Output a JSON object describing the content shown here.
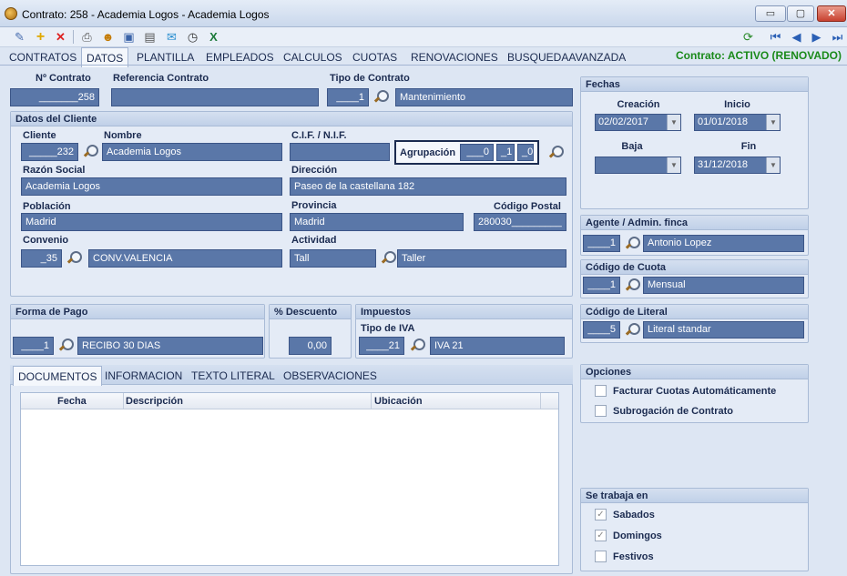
{
  "window": {
    "title": "Contrato: 258 - Academia Logos - Academia Logos",
    "minimize": "▭",
    "maximize": "▢",
    "close": "✕"
  },
  "tabs": [
    "CONTRATOS",
    "DATOS",
    "PLANTILLA",
    "EMPLEADOS",
    "CALCULOS",
    "CUOTAS",
    "RENOVACIONES",
    "BUSQUEDAAVANZADA"
  ],
  "status": "Contrato: ACTIVO (RENOVADO)",
  "contract": {
    "num_label": "Nº Contrato",
    "num_value": "_______258",
    "ref_label": "Referencia Contrato",
    "ref_value": "",
    "tipo_label": "Tipo de Contrato",
    "tipo_code": "____1",
    "tipo_value": "Mantenimiento"
  },
  "cliente": {
    "header": "Datos del Cliente",
    "cliente_label": "Cliente",
    "cliente_code": "_____232",
    "nombre_label": "Nombre",
    "nombre_value": "Academia Logos",
    "cif_label": "C.I.F. / N.I.F.",
    "cif_value": "",
    "agrupacion_label": "Agrupación",
    "agr1": "___0",
    "agr2": "_1",
    "agr3": "_0",
    "razon_label": "Razón Social",
    "razon_value": "Academia Logos",
    "direccion_label": "Dirección",
    "direccion_value": "Paseo de la castellana 182",
    "poblacion_label": "Población",
    "poblacion_value": "Madrid",
    "provincia_label": "Provincia",
    "provincia_value": "Madrid",
    "cp_label": "Código Postal",
    "cp_value": "280030_________",
    "convenio_label": "Convenio",
    "convenio_code": "_35",
    "convenio_value": "CONV.VALENCIA",
    "actividad_label": "Actividad",
    "actividad_code": "Tall",
    "actividad_value": "Taller"
  },
  "pago": {
    "header": "Forma de Pago",
    "code": "____1",
    "value": "RECIBO 30 DIAS"
  },
  "descuento": {
    "header": "% Descuento",
    "value": "0,00"
  },
  "impuestos": {
    "header": "Impuestos",
    "iva_label": "Tipo de IVA",
    "iva_code": "____21",
    "iva_value": "IVA 21"
  },
  "doc_tabs": [
    "DOCUMENTOS",
    "INFORMACION",
    "TEXTO LITERAL",
    "OBSERVACIONES"
  ],
  "grid": {
    "columns": [
      "Fecha",
      "Descripción",
      "Ubicación"
    ]
  },
  "fechas": {
    "header": "Fechas",
    "creacion_label": "Creación",
    "creacion_value": "02/02/2017",
    "inicio_label": "Inicio",
    "inicio_value": "01/01/2018",
    "baja_label": "Baja",
    "baja_value": "",
    "fin_label": "Fin",
    "fin_value": "31/12/2018"
  },
  "agente": {
    "header": "Agente / Admin. finca",
    "code": "____1",
    "value": "Antonio Lopez"
  },
  "cuota": {
    "header": "Código de Cuota",
    "code": "____1",
    "value": "Mensual"
  },
  "literal": {
    "header": "Código de Literal",
    "code": "____5",
    "value": "Literal standar"
  },
  "opciones": {
    "header": "Opciones",
    "items": [
      {
        "label": "Facturar Cuotas Automáticamente",
        "checked": false
      },
      {
        "label": "Subrogación de Contrato",
        "checked": false
      }
    ]
  },
  "trabaja": {
    "header": "Se trabaja en",
    "items": [
      {
        "label": "Sabados",
        "checked": true
      },
      {
        "label": "Domingos",
        "checked": true
      },
      {
        "label": "Festivos",
        "checked": false
      }
    ]
  },
  "icons": {
    "check": "✓",
    "arrow": "▼"
  }
}
